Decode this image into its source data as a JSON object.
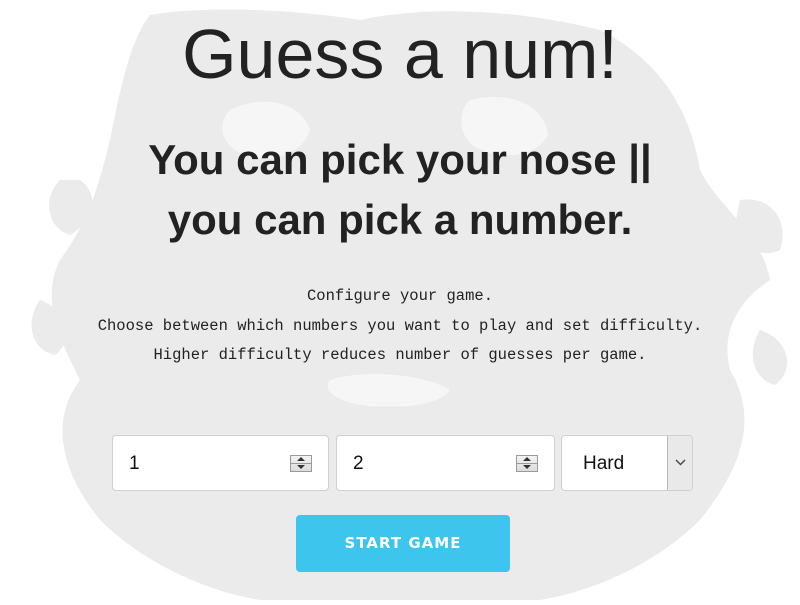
{
  "header": {
    "title": "Guess a num!",
    "subtitle_lines": [
      "You can pick your nose ||",
      "you can pick a number."
    ]
  },
  "instructions": {
    "lines": [
      "Configure your game.",
      "Choose between which numbers you want to play and set difficulty.",
      "Higher difficulty reduces number of guesses per game."
    ]
  },
  "config": {
    "min_value": "1",
    "max_value": "2",
    "difficulty": "Hard"
  },
  "actions": {
    "start_label": "START GAME"
  },
  "colors": {
    "accent": "#3ec5ee",
    "text": "#222222",
    "background_art": "#ebebeb"
  },
  "icons": {
    "spinner": "up-down-spinner-icon",
    "dropdown": "chevron-down-icon"
  }
}
